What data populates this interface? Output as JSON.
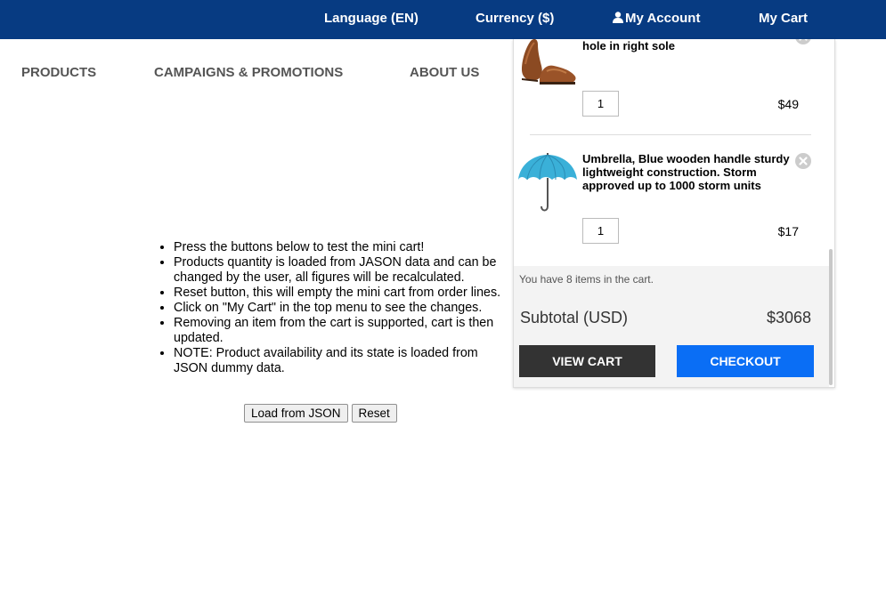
{
  "topbar": {
    "language": "Language (EN)",
    "currency": "Currency ($)",
    "account": "My Account",
    "cart": "My Cart",
    "background": "#073b82"
  },
  "mainnav": {
    "products": "PRODUCTS",
    "campaigns": "CAMPAIGNS & PROMOTIONS",
    "about": "ABOUT US"
  },
  "instructions": {
    "items": [
      "Press the buttons below to test the mini cart!",
      "Products quantity is loaded from JASON data and can be changed by the user, all figures will be recalculated.",
      "Reset button, this will empty the mini cart from order lines.",
      "Click on \"My Cart\" in the top menu to see the changes.",
      "Removing an item from the cart is supported, cart is then updated.",
      "NOTE: Product availability and its state is loaded from JSON dummy data."
    ],
    "load_label": "Load from JSON",
    "reset_label": "Reset"
  },
  "minicart": {
    "items": [
      {
        "name": "hole in right sole",
        "qty": "1",
        "price": "$49",
        "image_icon": "brown-shoes-icon"
      },
      {
        "name": "Umbrella, Blue wooden handle sturdy lightweight construction. Storm approved up to 1000 storm units",
        "qty": "1",
        "price": "$17",
        "image_icon": "umbrella-icon"
      }
    ],
    "items_note": "You have 8 items in the cart.",
    "subtotal_label": "Subtotal (USD)",
    "subtotal_value": "$3068",
    "view_cart_label": "VIEW CART",
    "checkout_label": "CHECKOUT",
    "colors": {
      "view_cart": "#333333",
      "checkout": "#0a6ef5"
    }
  }
}
